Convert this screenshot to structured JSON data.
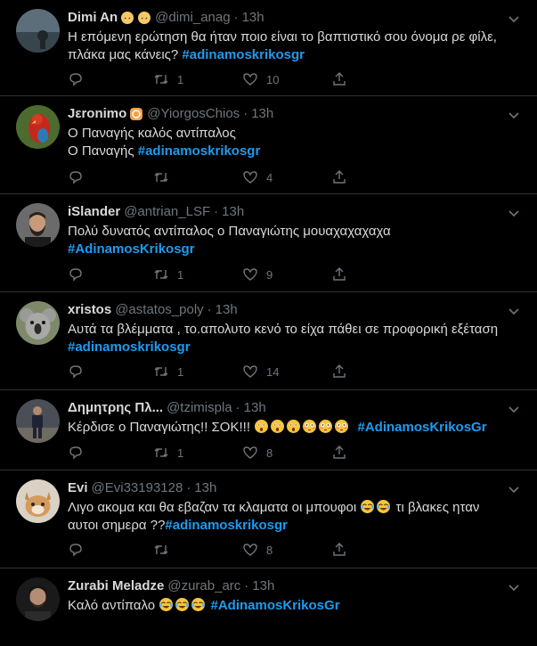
{
  "colors": {
    "background": "#000000",
    "text": "#d9d9d9",
    "muted": "#6e767d",
    "hashtag": "#1d9bf0",
    "border": "#2f3336"
  },
  "tweets": [
    {
      "name": "Dimi An",
      "name_emoji": [
        "blonde-person-emoji",
        "blonde-person-emoji"
      ],
      "handle": "@dimi_anag",
      "time": "13h",
      "lines": [
        {
          "text": "Η επόμενη ερώτηση θα ήταν ποιο είναι το βαπτιστικό σου όνομα ρε φίλε,",
          "tag": ""
        },
        {
          "text": "πλάκα μας κάνεις? ",
          "tag": "#adinamoskrikosgr"
        }
      ],
      "replies": "",
      "retweets": "1",
      "likes": "10",
      "avatar": "seaside-photo"
    },
    {
      "name": "Jεronimo",
      "name_emoji": [
        "emoji-badge"
      ],
      "handle": "@YiorgosChios",
      "time": "13h",
      "lines": [
        {
          "text": "Ο Παναγής καλός αντίπαλος",
          "tag": ""
        },
        {
          "text": "Ο Παναγής ",
          "tag": "#adinamoskrikosgr"
        }
      ],
      "replies": "",
      "retweets": "",
      "likes": "4",
      "avatar": "parrot-photo"
    },
    {
      "name": "iSlander",
      "name_emoji": [],
      "handle": "@antrian_LSF",
      "time": "13h",
      "lines": [
        {
          "text": "Πολύ δυνατός αντίπαλος ο Παναγιώτης μουαχαχαχαχα",
          "tag": ""
        },
        {
          "text": "",
          "tag": "#AdinamosKrikosgr"
        }
      ],
      "replies": "",
      "retweets": "1",
      "likes": "9",
      "avatar": "bearded-man-photo"
    },
    {
      "name": "xristos",
      "name_emoji": [],
      "handle": "@astatos_poly",
      "time": "13h",
      "lines": [
        {
          "text": "Αυτά τα βλέμματα , το.απολυτο κενό το είχα πάθει σε προφορική εξέταση",
          "tag": ""
        },
        {
          "text": "",
          "tag": "#adinamoskrikosgr"
        }
      ],
      "replies": "",
      "retweets": "1",
      "likes": "14",
      "avatar": "koala-photo"
    },
    {
      "name": "Δημητρης Πλ...",
      "name_emoji": [],
      "handle": "@tzimispla",
      "time": "13h",
      "lines": [
        {
          "text": "Κέρδισε ο Παναγιώτης!! ΣΟΚ!!! ",
          "tag": "#AdinamosKrikosGr",
          "emojis": [
            "astonished",
            "astonished",
            "astonished",
            "flushed",
            "flushed",
            "flushed"
          ]
        }
      ],
      "replies": "",
      "retweets": "1",
      "likes": "8",
      "avatar": "man-standing-photo"
    },
    {
      "name": "Evi",
      "name_emoji": [],
      "handle": "@Evi33193128",
      "time": "13h",
      "lines": [
        {
          "text": "Λιγο ακομα και θα εβαζαν τα κλαματα οι μπουφοι ",
          "tag": "",
          "emojis_after": [
            "joy",
            "joy"
          ],
          "after": " τι βλακες ηταν"
        },
        {
          "text": "αυτοι σημερα ??",
          "tag": "#adinamoskrikosgr"
        }
      ],
      "replies": "",
      "retweets": "",
      "likes": "8",
      "avatar": "kitten-photo"
    },
    {
      "name": "Zurabi Meladze",
      "name_emoji": [],
      "handle": "@zurab_arc",
      "time": "13h",
      "lines": [
        {
          "text": "Καλό αντίπαλο ",
          "tag": "#AdinamosKrikosGr",
          "emojis": [
            "joy",
            "joy",
            "joy"
          ]
        }
      ],
      "replies": "",
      "retweets": "",
      "likes": "",
      "avatar": "dark-portrait-photo"
    }
  ]
}
